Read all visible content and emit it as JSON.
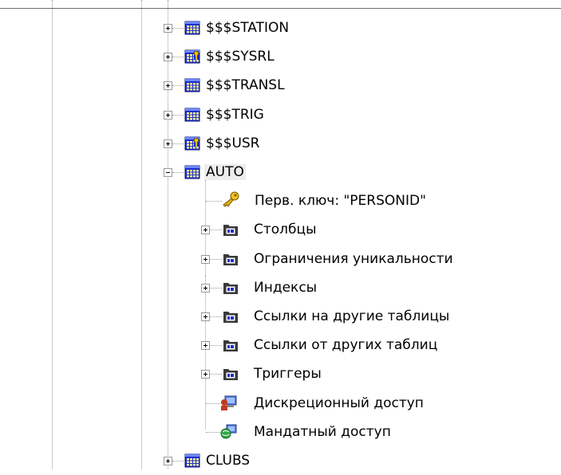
{
  "tree": {
    "tables_before": [
      {
        "label": "$$$STATION",
        "icon": "table-icon"
      },
      {
        "label": "$$$SYSRL",
        "icon": "system-table-icon"
      },
      {
        "label": "$$$TRANSL",
        "icon": "table-icon"
      },
      {
        "label": "$$$TRIG",
        "icon": "table-icon"
      },
      {
        "label": "$$$USR",
        "icon": "system-table-icon"
      }
    ],
    "expanded_table": {
      "label": "AUTO",
      "icon": "table-icon",
      "children": [
        {
          "label": "Перв. ключ: \"PERSONID\"",
          "icon": "key-icon",
          "expandable": false
        },
        {
          "label": "Столбцы",
          "icon": "folder-icon",
          "expandable": true
        },
        {
          "label": "Ограничения уникальности",
          "icon": "folder-icon",
          "expandable": true
        },
        {
          "label": "Индексы",
          "icon": "folder-icon",
          "expandable": true
        },
        {
          "label": "Ссылки на другие таблицы",
          "icon": "folder-icon",
          "expandable": true
        },
        {
          "label": "Ссылки от других таблиц",
          "icon": "folder-icon",
          "expandable": true
        },
        {
          "label": "Триггеры",
          "icon": "folder-icon",
          "expandable": true
        },
        {
          "label": "Дискреционный доступ",
          "icon": "discretionary-access-icon",
          "expandable": false
        },
        {
          "label": "Мандатный доступ",
          "icon": "mandatory-access-icon",
          "expandable": false
        }
      ]
    },
    "tables_after": [
      {
        "label": "CLUBS",
        "icon": "table-icon"
      }
    ]
  }
}
